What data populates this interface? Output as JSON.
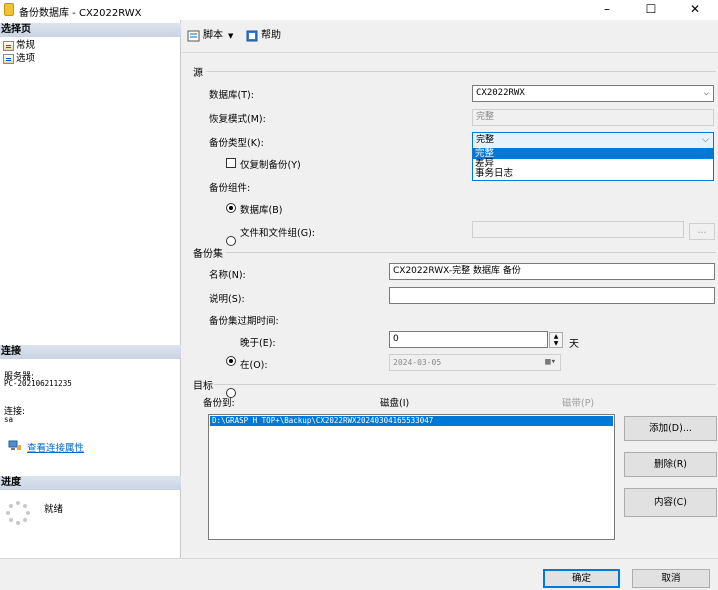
{
  "window": {
    "title": "备份数据库 - CX2022RWX",
    "minimize": "–",
    "maximize": "☐",
    "close": "✕"
  },
  "left": {
    "select_page_header": "选择页",
    "pages": [
      "常规",
      "选项"
    ],
    "connection_header": "连接",
    "server_label": "服务器:",
    "server_value": "PC-202106211235",
    "connection_label": "连接:",
    "connection_value": "sa",
    "view_props_link": "查看连接属性",
    "progress_header": "进度",
    "progress_status": "就绪"
  },
  "toolbar": {
    "script_label": "脚本",
    "help_label": "帮助"
  },
  "source": {
    "header": "源",
    "database_label": "数据库(T):",
    "database_value": "CX2022RWX",
    "recovery_label": "恢复模式(M):",
    "recovery_value": "完整",
    "backup_type_label": "备份类型(K):",
    "backup_type_value": "完整",
    "backup_type_options": [
      "完整",
      "差异",
      "事务日志"
    ],
    "copy_only_label": "仅复制备份(Y)",
    "component_label": "备份组件:",
    "component_database": "数据库(B)",
    "component_files": "文件和文件组(G):",
    "files_button": "..."
  },
  "backup_set": {
    "header": "备份集",
    "name_label": "名称(N):",
    "name_value": "CX2022RWX-完整 数据库 备份",
    "description_label": "说明(S):",
    "description_value": "",
    "expire_label": "备份集过期时间:",
    "after_label": "晚于(E):",
    "after_value": "0",
    "days_label": "天",
    "on_label": "在(O):",
    "on_value": "2024-03-05"
  },
  "destination": {
    "header": "目标",
    "backup_to_label": "备份到:",
    "disk_label": "磁盘(I)",
    "tape_label": "磁带(P)",
    "paths": [
      "D:\\GRASP H TOP+\\Backup\\CX2022RWX20240304165533047"
    ],
    "add_button": "添加(D)...",
    "remove_button": "删除(R)",
    "contents_button": "内容(C)"
  },
  "footer": {
    "ok_button": "确定",
    "cancel_button": "取消"
  },
  "colors": {
    "accent": "#0078d7",
    "link": "#0066cc"
  }
}
